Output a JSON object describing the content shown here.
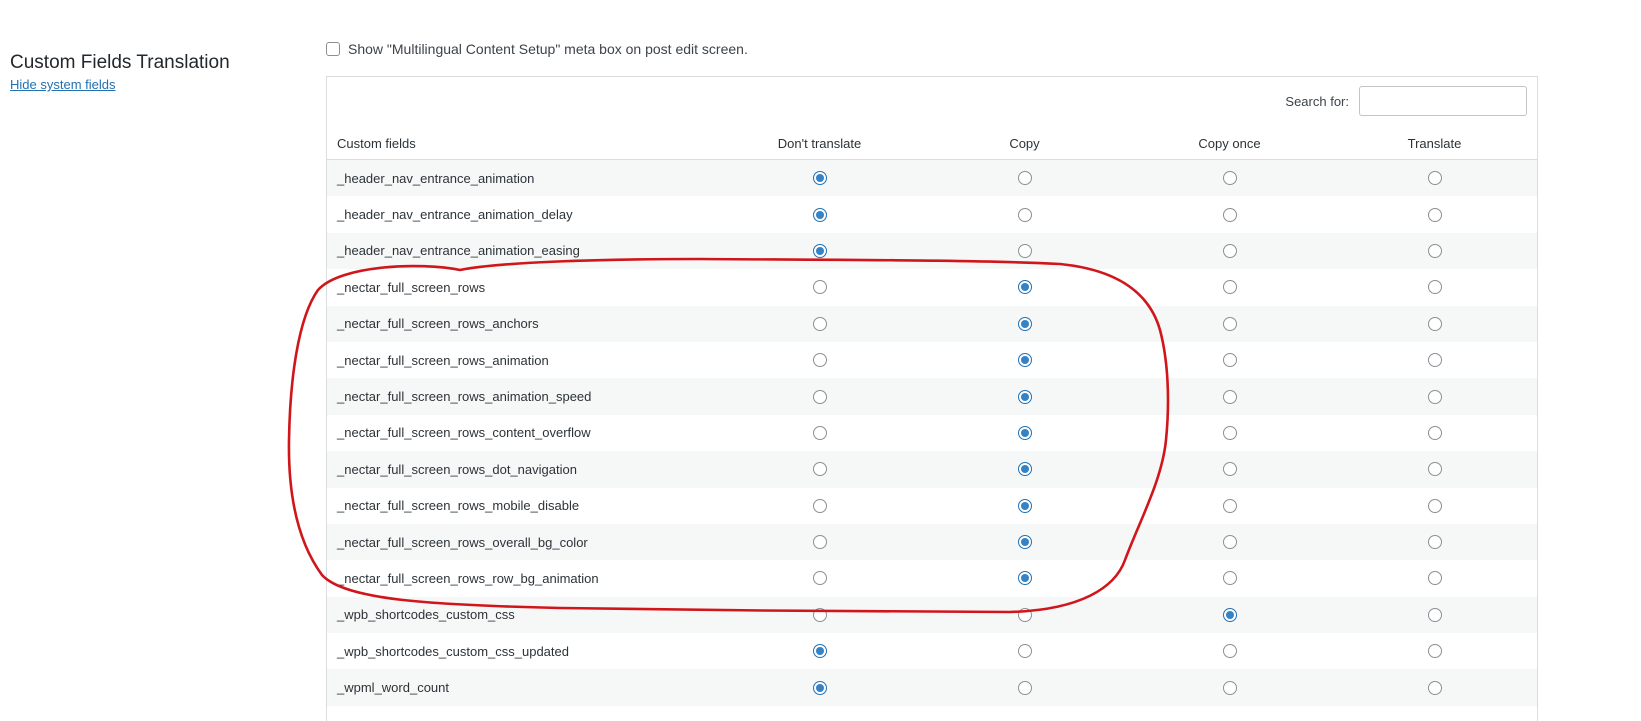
{
  "section": {
    "title": "Custom Fields Translation",
    "hide_link": "Hide system fields"
  },
  "meta_option": {
    "label": "Show \"Multilingual Content Setup\" meta box on post edit screen.",
    "checked": false
  },
  "search": {
    "label": "Search for:",
    "value": ""
  },
  "table": {
    "headers": [
      "Custom fields",
      "Don't translate",
      "Copy",
      "Copy once",
      "Translate"
    ],
    "rows": [
      {
        "name": "_header_nav_entrance_animation",
        "selected": 0
      },
      {
        "name": "_header_nav_entrance_animation_delay",
        "selected": 0
      },
      {
        "name": "_header_nav_entrance_animation_easing",
        "selected": 0
      },
      {
        "name": "_nectar_full_screen_rows",
        "selected": 1
      },
      {
        "name": "_nectar_full_screen_rows_anchors",
        "selected": 1
      },
      {
        "name": "_nectar_full_screen_rows_animation",
        "selected": 1
      },
      {
        "name": "_nectar_full_screen_rows_animation_speed",
        "selected": 1
      },
      {
        "name": "_nectar_full_screen_rows_content_overflow",
        "selected": 1
      },
      {
        "name": "_nectar_full_screen_rows_dot_navigation",
        "selected": 1
      },
      {
        "name": "_nectar_full_screen_rows_mobile_disable",
        "selected": 1
      },
      {
        "name": "_nectar_full_screen_rows_overall_bg_color",
        "selected": 1
      },
      {
        "name": "_nectar_full_screen_rows_row_bg_animation",
        "selected": 1
      },
      {
        "name": "_wpb_shortcodes_custom_css",
        "selected": 2
      },
      {
        "name": "_wpb_shortcodes_custom_css_updated",
        "selected": 0
      },
      {
        "name": "_wpml_word_count",
        "selected": 0
      }
    ]
  },
  "colors": {
    "link": "#2271b1",
    "radio_checked": "#3582c4",
    "annotation": "#d0161b",
    "row_alt": "#f6f7f7"
  }
}
